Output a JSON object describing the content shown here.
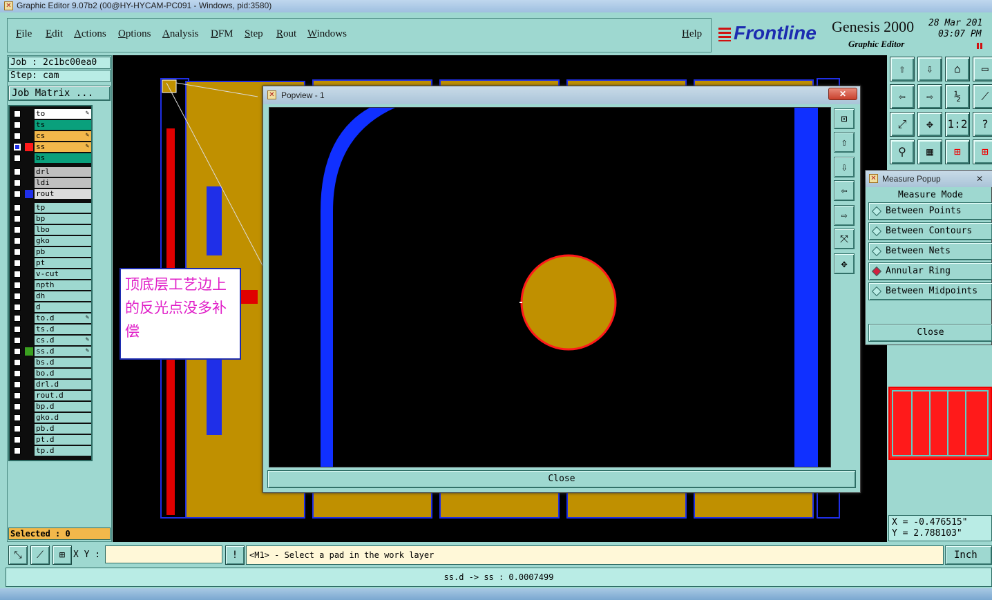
{
  "window": {
    "title": "Graphic Editor 9.07b2 (00@HY-HYCAM-PC091 - Windows, pid:3580)"
  },
  "menu": {
    "items": [
      "File",
      "Edit",
      "Actions",
      "Options",
      "Analysis",
      "DFM",
      "Step",
      "Rout",
      "Windows"
    ],
    "help": "Help"
  },
  "brand": {
    "logo": "Frontline",
    "product": "Genesis 2000",
    "subtitle": "Graphic Editor",
    "date": "28 Mar 201",
    "time": "03:07 PM"
  },
  "job": {
    "job_line": "Job : 2c1bc00ea0",
    "step_line": "Step: cam",
    "matrix_button": "Job Matrix ..."
  },
  "layers": [
    {
      "name": "to",
      "color": "#ffffff",
      "mark": "",
      "pen": true
    },
    {
      "name": "ts",
      "color": "#0aa07c",
      "mark": "",
      "pen": false
    },
    {
      "name": "cs",
      "color": "#f2b84b",
      "mark": "",
      "pen": true
    },
    {
      "name": "ss",
      "color": "#f2b84b",
      "mark": "#ff1a1a",
      "pen": true,
      "checked": true
    },
    {
      "name": "bs",
      "color": "#0aa07c",
      "mark": "",
      "pen": false
    },
    {
      "name": "drl",
      "color": "#bfbfbf",
      "mark": "",
      "pen": false
    },
    {
      "name": "ldi",
      "color": "#bfbfbf",
      "mark": "",
      "pen": false
    },
    {
      "name": "rout",
      "color": "#dcdcdc",
      "mark": "#1f2fe8",
      "pen": false
    },
    {
      "name": "tp",
      "color": "#9ed8d0",
      "mark": "",
      "pen": false
    },
    {
      "name": "bp",
      "color": "#9ed8d0",
      "mark": "",
      "pen": false
    },
    {
      "name": "lbo",
      "color": "#9ed8d0",
      "mark": "",
      "pen": false
    },
    {
      "name": "gko",
      "color": "#9ed8d0",
      "mark": "",
      "pen": false
    },
    {
      "name": "pb",
      "color": "#9ed8d0",
      "mark": "",
      "pen": false
    },
    {
      "name": "pt",
      "color": "#9ed8d0",
      "mark": "",
      "pen": false
    },
    {
      "name": "v-cut",
      "color": "#9ed8d0",
      "mark": "",
      "pen": false
    },
    {
      "name": "npth",
      "color": "#9ed8d0",
      "mark": "",
      "pen": false
    },
    {
      "name": "dh",
      "color": "#9ed8d0",
      "mark": "",
      "pen": false
    },
    {
      "name": "d",
      "color": "#9ed8d0",
      "mark": "",
      "pen": false
    },
    {
      "name": "to.d",
      "color": "#9ed8d0",
      "mark": "",
      "pen": true
    },
    {
      "name": "ts.d",
      "color": "#9ed8d0",
      "mark": "",
      "pen": false
    },
    {
      "name": "cs.d",
      "color": "#9ed8d0",
      "mark": "",
      "pen": true
    },
    {
      "name": "ss.d",
      "color": "#9ed8d0",
      "mark": "#3aa020",
      "pen": true
    },
    {
      "name": "bs.d",
      "color": "#9ed8d0",
      "mark": "",
      "pen": false
    },
    {
      "name": "bo.d",
      "color": "#9ed8d0",
      "mark": "",
      "pen": false
    },
    {
      "name": "drl.d",
      "color": "#9ed8d0",
      "mark": "",
      "pen": false
    },
    {
      "name": "rout.d",
      "color": "#9ed8d0",
      "mark": "",
      "pen": false
    },
    {
      "name": "bp.d",
      "color": "#9ed8d0",
      "mark": "",
      "pen": false
    },
    {
      "name": "gko.d",
      "color": "#9ed8d0",
      "mark": "",
      "pen": false
    },
    {
      "name": "pb.d",
      "color": "#9ed8d0",
      "mark": "",
      "pen": false
    },
    {
      "name": "pt.d",
      "color": "#9ed8d0",
      "mark": "",
      "pen": false
    },
    {
      "name": "tp.d",
      "color": "#9ed8d0",
      "mark": "",
      "pen": false
    }
  ],
  "selected": "Selected : 0",
  "callout": {
    "text": "顶底层工艺边上的反光点没多补偿"
  },
  "popview": {
    "title": "Popview - 1",
    "close": "Close",
    "close_x": "✕"
  },
  "measure": {
    "title": "Measure Popup",
    "mode_label": "Measure Mode",
    "options": [
      "Between Points",
      "Between Contours",
      "Between Nets",
      "Annular Ring",
      "Between Midpoints"
    ],
    "selected_option": "Annular Ring",
    "close": "Close"
  },
  "coords": {
    "x": "X = -0.476515\"",
    "y": "Y = 2.788103\""
  },
  "bottom": {
    "xy_label": "X Y :",
    "prompt": "<M1> - Select a pad in the work layer",
    "units": "Inch",
    "status": "ss.d -> ss : 0.0007499"
  },
  "icons": {
    "toolbar": [
      "up-arrow-icon",
      "down-arrow-icon",
      "home-icon",
      "frame-icon",
      "left-arrow-icon",
      "right-arrow-icon",
      "half-scale-icon",
      "snap-icon",
      "zoom-fit-icon",
      "zoom-center-icon",
      "scale-1-2-icon",
      "help-icon",
      "probe-icon",
      "grid-icon",
      "net-highlight-icon",
      "net-select-icon"
    ],
    "popview_tools": [
      "zoom-area-icon",
      "pan-up-icon",
      "pan-down-icon",
      "pan-left-icon",
      "pan-right-icon",
      "zoom-out-icon",
      "zoom-home-icon"
    ]
  }
}
